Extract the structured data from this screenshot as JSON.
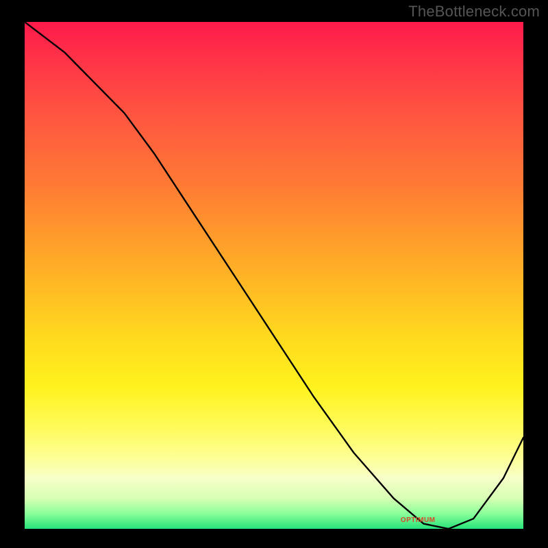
{
  "watermark": "TheBottleneck.com",
  "annotation_label": "OPTIMUM",
  "chart_data": {
    "type": "line",
    "title": "",
    "xlabel": "",
    "ylabel": "",
    "xlim": [
      0,
      100
    ],
    "ylim": [
      0,
      100
    ],
    "note": "No numeric axis ticks are visible; values are estimated from pixel positions on a 0–100 normalized scale.",
    "series": [
      {
        "name": "bottleneck-curve",
        "x": [
          0,
          8,
          14,
          20,
          26,
          34,
          42,
          50,
          58,
          66,
          74,
          80,
          85,
          90,
          96,
          100
        ],
        "y": [
          100,
          94,
          88,
          82,
          74,
          62,
          50,
          38,
          26,
          15,
          6,
          1,
          0,
          2,
          10,
          18
        ]
      }
    ],
    "optimum_x": 85,
    "background_gradient": {
      "top_color": "#ff1a4b",
      "mid_color": "#ffd91e",
      "bottom_color": "#27e27a"
    }
  }
}
